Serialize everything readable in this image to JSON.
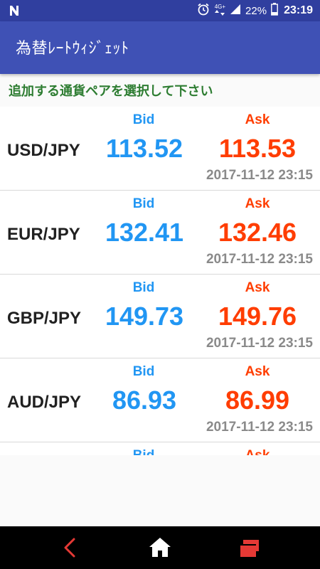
{
  "status_bar": {
    "network": "4G+",
    "battery": "22%",
    "time": "23:19"
  },
  "app_bar": {
    "title": "為替ﾚｰﾄｳｨｼﾞｪｯﾄ"
  },
  "subtitle": "追加する通貨ペアを選択して下さい",
  "pairs": [
    {
      "pair": "USD/JPY",
      "bid_label": "Bid",
      "ask_label": "Ask",
      "bid": "113.52",
      "ask": "113.53",
      "timestamp": "2017-11-12 23:15"
    },
    {
      "pair": "EUR/JPY",
      "bid_label": "Bid",
      "ask_label": "Ask",
      "bid": "132.41",
      "ask": "132.46",
      "timestamp": "2017-11-12 23:15"
    },
    {
      "pair": "GBP/JPY",
      "bid_label": "Bid",
      "ask_label": "Ask",
      "bid": "149.73",
      "ask": "149.76",
      "timestamp": "2017-11-12 23:15"
    },
    {
      "pair": "AUD/JPY",
      "bid_label": "Bid",
      "ask_label": "Ask",
      "bid": "86.93",
      "ask": "86.99",
      "timestamp": "2017-11-12 23:15"
    },
    {
      "pair": "",
      "bid_label": "Bid",
      "ask_label": "Ask",
      "bid": "",
      "ask": "",
      "timestamp": ""
    }
  ],
  "colors": {
    "status_bar": "#303f9f",
    "app_bar": "#3f51b5",
    "bid": "#2196f3",
    "ask": "#ff3d00",
    "subtitle": "#2e7d32",
    "timestamp": "#8a8a8a",
    "nav_accent": "#e53935"
  },
  "nav": {
    "back_icon": "back-chevron-icon",
    "home_icon": "home-icon",
    "recent_icon": "recent-apps-icon"
  }
}
